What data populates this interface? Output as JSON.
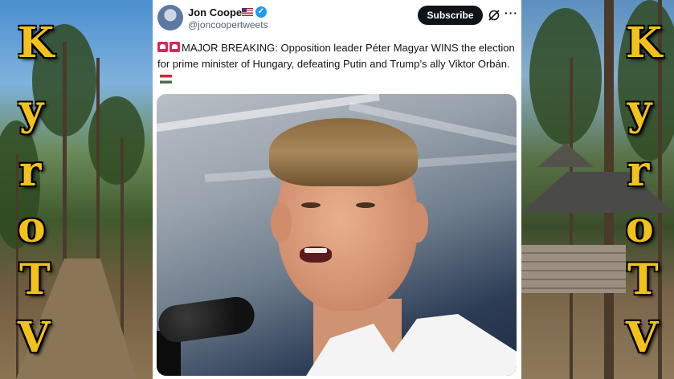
{
  "watermark": {
    "left": [
      "K",
      "y",
      "r",
      "o",
      "T",
      "V"
    ],
    "right": [
      "K",
      "y",
      "r",
      "o",
      "T",
      "V"
    ],
    "color": "#f2c21a"
  },
  "tweet": {
    "author_name": "Jon Cooper",
    "author_handle": "@joncoopertweets",
    "subscribe_label": "Subscribe",
    "text": "MAJOR BREAKING: Opposition leader Péter Magyar WINS the election for prime minister of Hungary, defeating Putin and Trump’s ally Viktor Orbán.",
    "icons": {
      "flag": "us-flag-icon",
      "verified": "verified-badge-icon",
      "grok": "grok-icon",
      "more": "more-icon",
      "siren": "police-light-icon",
      "country_flag": "hungary-flag-icon"
    },
    "accent_color": "#1d9bf0"
  }
}
